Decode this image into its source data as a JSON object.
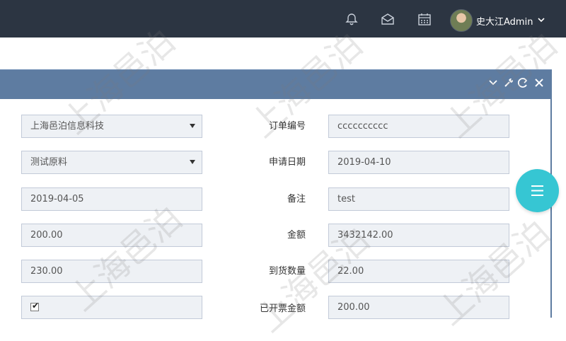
{
  "header": {
    "username": "史大江Admin",
    "icons": [
      "bell-icon",
      "envelope-icon",
      "calendar-icon",
      "chevron-down-icon"
    ]
  },
  "portlet": {
    "tools": [
      "collapse-icon",
      "wrench-icon",
      "reload-icon",
      "close-icon"
    ]
  },
  "form": {
    "left": {
      "company_select": "上海邑泊信息科技",
      "material_select": "测试原料",
      "date_field": "2019-04-05",
      "amount_field_1": "200.00",
      "amount_field_2": "230.00",
      "checkbox_checked": true
    },
    "right": {
      "order_no_label": "订单编号",
      "order_no_value": "cccccccccc",
      "apply_date_label": "申请日期",
      "apply_date_value": "2019-04-10",
      "remark_label": "备注",
      "remark_value": "test",
      "amount_label": "金额",
      "amount_value": "3432142.00",
      "arrival_qty_label": "到货数量",
      "arrival_qty_value": "22.00",
      "invoiced_amount_label": "已开票金额",
      "invoiced_amount_value": "200.00"
    }
  },
  "watermark_text": "上海邑泊",
  "colors": {
    "topbar": "#2c3542",
    "portlet_header": "#5e7ca1",
    "fab": "#36c6d3",
    "field_bg": "#eef1f5"
  }
}
